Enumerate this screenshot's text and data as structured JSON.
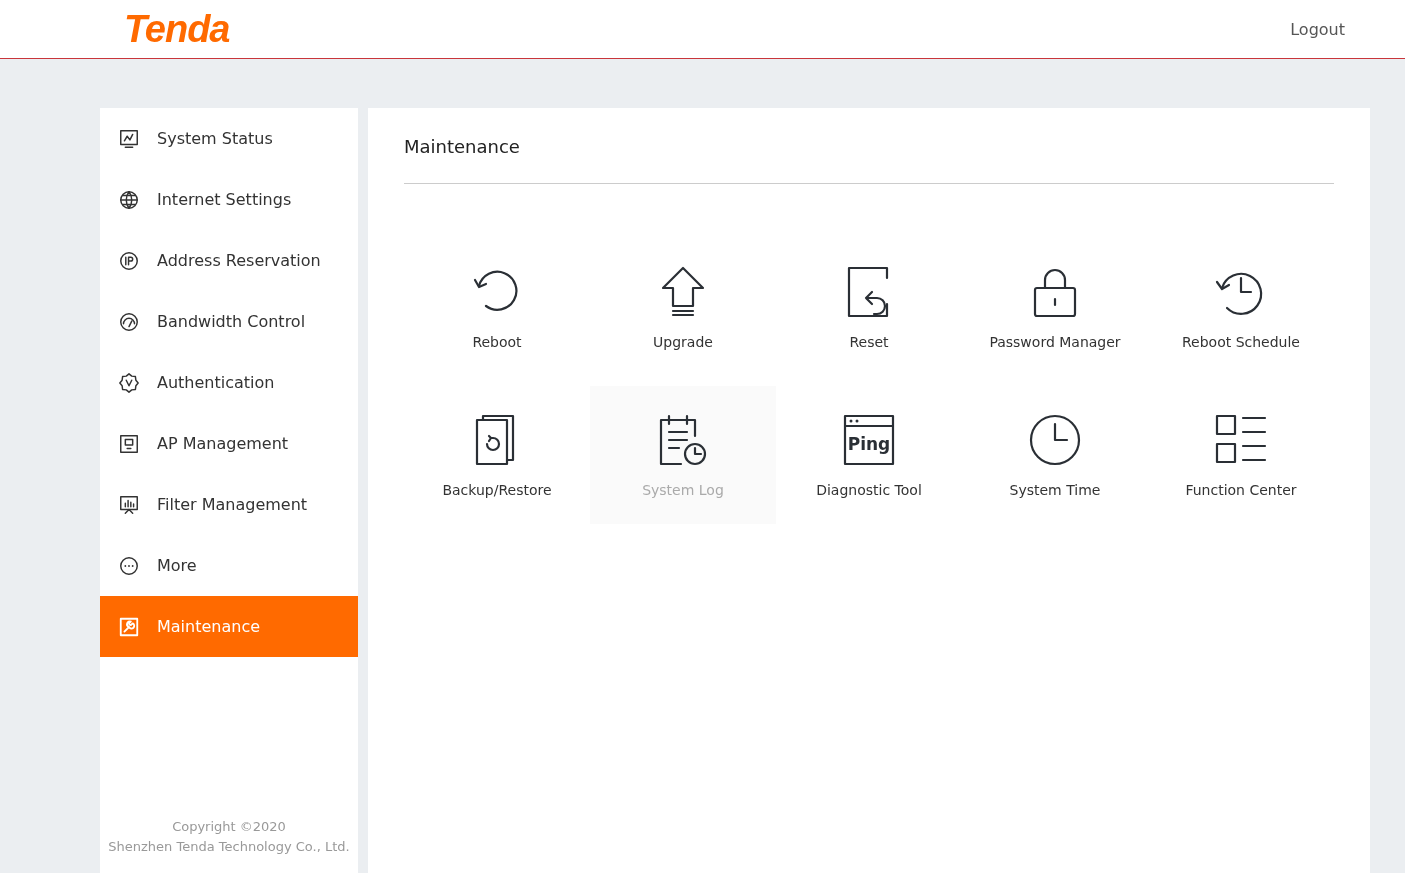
{
  "header": {
    "logo": "Tenda",
    "logout": "Logout"
  },
  "sidebar": {
    "items": [
      {
        "label": "System Status",
        "kind": "monitor",
        "selected": false
      },
      {
        "label": "Internet Settings",
        "kind": "globe",
        "selected": false
      },
      {
        "label": "Address Reservation",
        "kind": "ip",
        "selected": false
      },
      {
        "label": "Bandwidth Control",
        "kind": "gauge",
        "selected": false
      },
      {
        "label": "Authentication",
        "kind": "badge",
        "selected": false
      },
      {
        "label": "AP Management",
        "kind": "ap",
        "selected": false
      },
      {
        "label": "Filter Management",
        "kind": "chart",
        "selected": false
      },
      {
        "label": "More",
        "kind": "more",
        "selected": false
      },
      {
        "label": "Maintenance",
        "kind": "wrench",
        "selected": true
      }
    ],
    "copyright": [
      "Copyright ©2020",
      "Shenzhen Tenda Technology Co., Ltd."
    ]
  },
  "content": {
    "title": "Maintenance",
    "tools": [
      {
        "label": "Reboot",
        "kind": "reboot",
        "selected": false
      },
      {
        "label": "Upgrade",
        "kind": "upgrade",
        "selected": false
      },
      {
        "label": "Reset",
        "kind": "reset",
        "selected": false
      },
      {
        "label": "Password Manager",
        "kind": "lock",
        "selected": false
      },
      {
        "label": "Reboot Schedule",
        "kind": "history",
        "selected": false
      },
      {
        "label": "Backup/Restore",
        "kind": "backup",
        "selected": false
      },
      {
        "label": "System Log",
        "kind": "log",
        "selected": true
      },
      {
        "label": "Diagnostic Tool",
        "kind": "ping",
        "icon_text": "Ping",
        "selected": false
      },
      {
        "label": "System Time",
        "kind": "clock",
        "selected": false
      },
      {
        "label": "Function Center",
        "kind": "list",
        "selected": false
      }
    ]
  }
}
